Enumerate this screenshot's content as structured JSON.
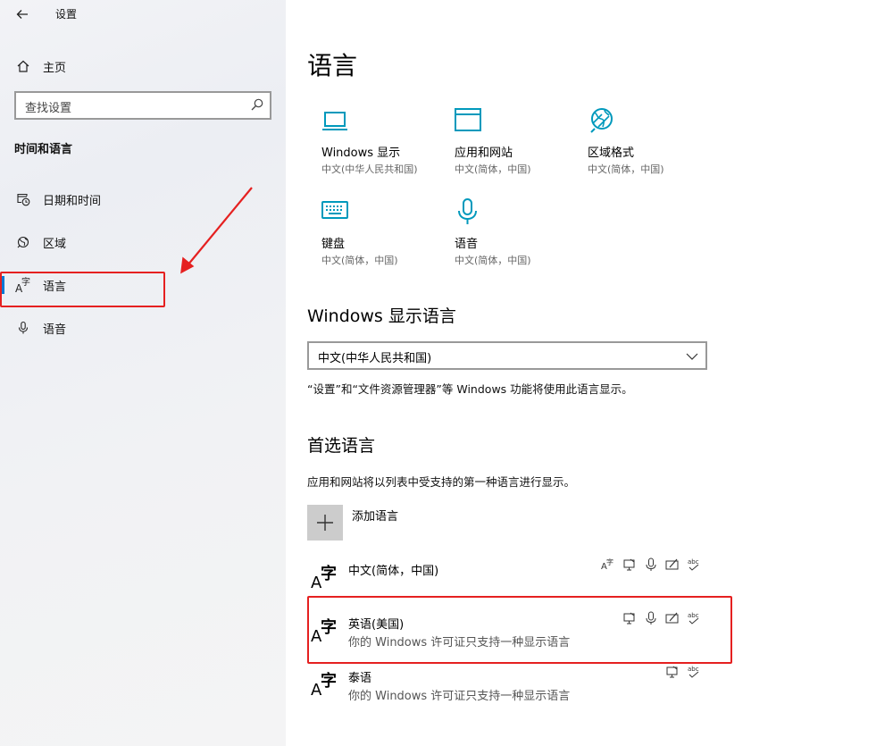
{
  "window": {
    "title": "设置"
  },
  "sidebar": {
    "home_label": "主页",
    "search_placeholder": "查找设置",
    "section_title": "时间和语言",
    "items": [
      {
        "label": "日期和时间",
        "icon": "calendar-clock-icon"
      },
      {
        "label": "区域",
        "icon": "globe-icon"
      },
      {
        "label": "语言",
        "icon": "language-icon",
        "selected": true
      },
      {
        "label": "语音",
        "icon": "microphone-icon"
      }
    ]
  },
  "main": {
    "title": "语言",
    "tiles": [
      {
        "title": "Windows 显示",
        "sub": "中文(中华人民共和国)",
        "icon": "monitor-icon"
      },
      {
        "title": "应用和网站",
        "sub": "中文(简体，中国)",
        "icon": "app-window-icon"
      },
      {
        "title": "区域格式",
        "sub": "中文(简体，中国)",
        "icon": "region-globe-icon"
      },
      {
        "title": "键盘",
        "sub": "中文(简体，中国)",
        "icon": "keyboard-icon"
      },
      {
        "title": "语音",
        "sub": "中文(简体，中国)",
        "icon": "microphone-icon"
      }
    ],
    "display_lang": {
      "heading": "Windows 显示语言",
      "selected": "中文(中华人民共和国)",
      "desc": "“设置”和“文件资源管理器”等 Windows 功能将使用此语言显示。"
    },
    "preferred": {
      "heading": "首选语言",
      "desc": "应用和网站将以列表中受支持的第一种语言进行显示。",
      "add_label": "添加语言",
      "languages": [
        {
          "name": "中文(简体，中国)",
          "note": ""
        },
        {
          "name": "英语(美国)",
          "note": "你的 Windows 许可证只支持一种显示语言"
        },
        {
          "name": "泰语",
          "note": "你的 Windows 许可证只支持一种显示语言"
        }
      ]
    }
  },
  "glyphs": {
    "lang_a": "A",
    "lang_z": "字",
    "plus": "+"
  },
  "colors": {
    "accent": "#0078d4",
    "tile_icon": "#0099bc",
    "annotation": "#e52020"
  }
}
